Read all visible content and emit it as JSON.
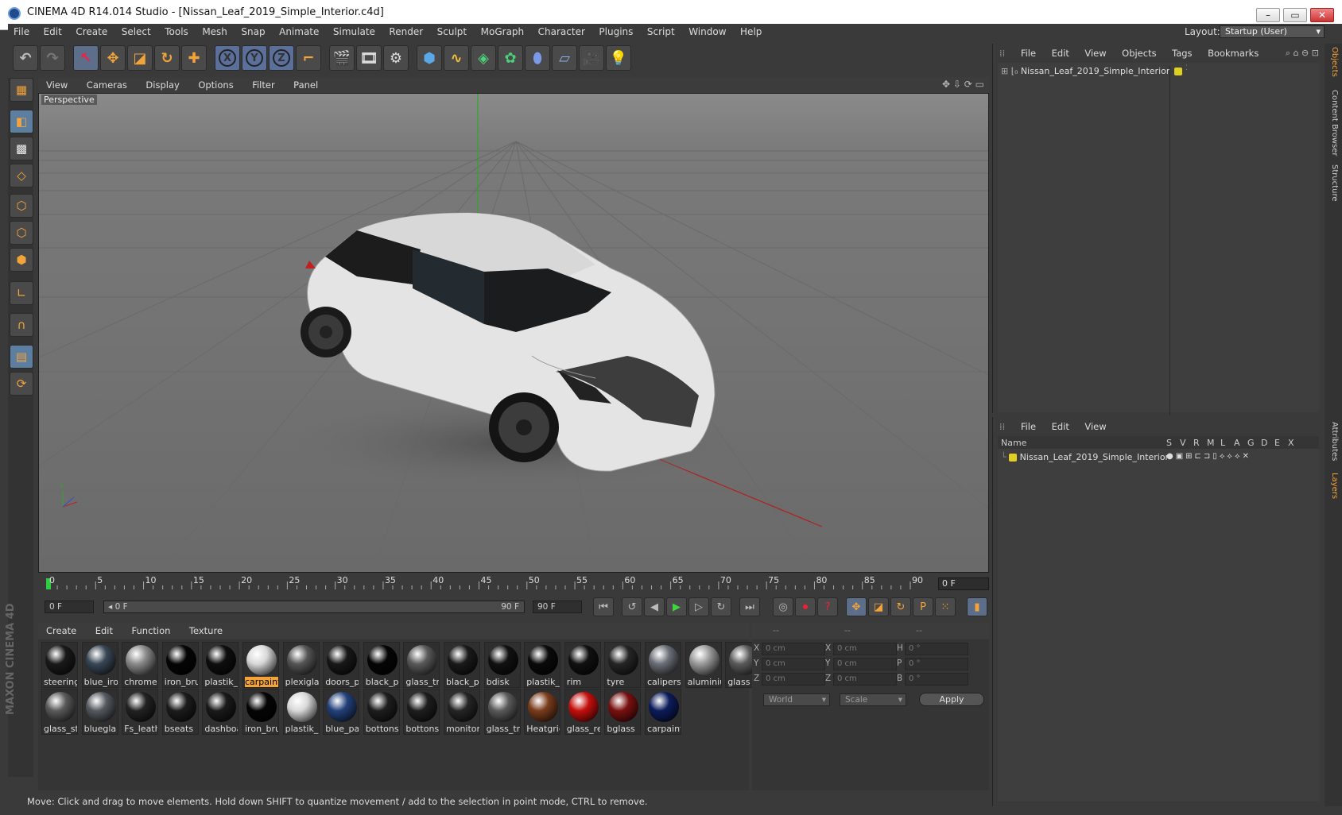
{
  "window": {
    "title": "CINEMA 4D R14.014 Studio - [Nissan_Leaf_2019_Simple_Interior.c4d]",
    "controls": [
      "–",
      "▭",
      "✕"
    ]
  },
  "menubar": {
    "items": [
      "File",
      "Edit",
      "Create",
      "Select",
      "Tools",
      "Mesh",
      "Snap",
      "Animate",
      "Simulate",
      "Render",
      "Sculpt",
      "MoGraph",
      "Character",
      "Plugins",
      "Script",
      "Window",
      "Help"
    ],
    "layout_label": "Layout:",
    "layout_value": "Startup (User)"
  },
  "toolbar": {
    "axis_x": "X",
    "axis_y": "Y",
    "axis_z": "Z"
  },
  "viewport": {
    "menu": [
      "View",
      "Cameras",
      "Display",
      "Options",
      "Filter",
      "Panel"
    ],
    "label": "Perspective"
  },
  "timeline": {
    "ticks": [
      "0",
      "5",
      "10",
      "15",
      "20",
      "25",
      "30",
      "35",
      "40",
      "45",
      "50",
      "55",
      "60",
      "65",
      "70",
      "75",
      "80",
      "85",
      "90"
    ],
    "current_frame": "0 F",
    "start_frame": "0 F",
    "range_start": "0 F",
    "range_end": "90 F",
    "end_frame": "90 F"
  },
  "materials": {
    "menu": [
      "Create",
      "Edit",
      "Function",
      "Texture"
    ],
    "row1": [
      {
        "name": "steering",
        "color": "#1a1a1a"
      },
      {
        "name": "blue_iro",
        "color": "#394655"
      },
      {
        "name": "chrome",
        "color": "#8a8a8a"
      },
      {
        "name": "iron_bru",
        "color": "#050505"
      },
      {
        "name": "plastik_",
        "color": "#0e0e0e"
      },
      {
        "name": "carpaint",
        "color": "#d8d8d8",
        "selected": true
      },
      {
        "name": "plexigla",
        "color": "#555555"
      },
      {
        "name": "doors_p",
        "color": "#181818"
      },
      {
        "name": "black_p",
        "color": "#050505"
      },
      {
        "name": "glass_tr",
        "color": "#5a5a5a"
      },
      {
        "name": "black_p",
        "color": "#1a1a1a"
      },
      {
        "name": "bdisk",
        "color": "#111111"
      },
      {
        "name": "plastik_l",
        "color": "#0a0a0a"
      },
      {
        "name": "rim",
        "color": "#101010"
      },
      {
        "name": "tyre",
        "color": "#262626"
      },
      {
        "name": "calipers",
        "color": "#6a6e76"
      },
      {
        "name": "aluminiu",
        "color": "#9a9a9a"
      },
      {
        "name": "glass",
        "color": "#5a5a5a"
      }
    ],
    "row2": [
      {
        "name": "glass_st",
        "color": "#5a5a5a"
      },
      {
        "name": "bluegla",
        "color": "#555a60"
      },
      {
        "name": "Fs_leath",
        "color": "#222222"
      },
      {
        "name": "bseats",
        "color": "#1c1c1c"
      },
      {
        "name": "dashboa",
        "color": "#1a1a1a"
      },
      {
        "name": "iron_bru",
        "color": "#050505"
      },
      {
        "name": "plastik_",
        "color": "#d8d8d8"
      },
      {
        "name": "blue_pa",
        "color": "#23417a"
      },
      {
        "name": "bottons",
        "color": "#1e1e1e"
      },
      {
        "name": "bottons",
        "color": "#1e1e1e"
      },
      {
        "name": "monitor",
        "color": "#252525"
      },
      {
        "name": "glass_tr",
        "color": "#5a5a5a"
      },
      {
        "name": "Heatgrid",
        "color": "#7a3c1c"
      },
      {
        "name": "glass_re",
        "color": "#c4100c"
      },
      {
        "name": "bglass",
        "color": "#7a1010"
      },
      {
        "name": "carpaint",
        "color": "#0c1c5c"
      }
    ]
  },
  "coordinates": {
    "header": [
      "--",
      "--",
      "--"
    ],
    "rows": [
      {
        "a": "X",
        "av": "0 cm",
        "b": "X",
        "bv": "0 cm",
        "c": "H",
        "cv": "0 °"
      },
      {
        "a": "Y",
        "av": "0 cm",
        "b": "Y",
        "bv": "0 cm",
        "c": "P",
        "cv": "0 °"
      },
      {
        "a": "Z",
        "av": "0 cm",
        "b": "Z",
        "bv": "0 cm",
        "c": "B",
        "cv": "0 °"
      }
    ],
    "mode": "World",
    "transform": "Scale",
    "apply": "Apply"
  },
  "status": "Move: Click and drag to move elements. Hold down SHIFT to quantize movement / add to the selection in point mode, CTRL to remove.",
  "objects_panel": {
    "menu": [
      "File",
      "Edit",
      "View",
      "Objects",
      "Tags",
      "Bookmarks"
    ],
    "object_name": "Nissan_Leaf_2019_Simple_Interior",
    "object_color": "#e0d020"
  },
  "layers_panel": {
    "menu": [
      "File",
      "Edit",
      "View"
    ],
    "col_name": "Name",
    "cols": [
      "S",
      "V",
      "R",
      "M",
      "L",
      "A",
      "G",
      "D",
      "E",
      "X"
    ],
    "layer_name": "Nissan_Leaf_2019_Simple_Interior"
  },
  "side_tabs": [
    "Objects",
    "Content Browser",
    "Structure",
    "Attributes",
    "Layers"
  ],
  "branding": "MAXON CINEMA 4D"
}
